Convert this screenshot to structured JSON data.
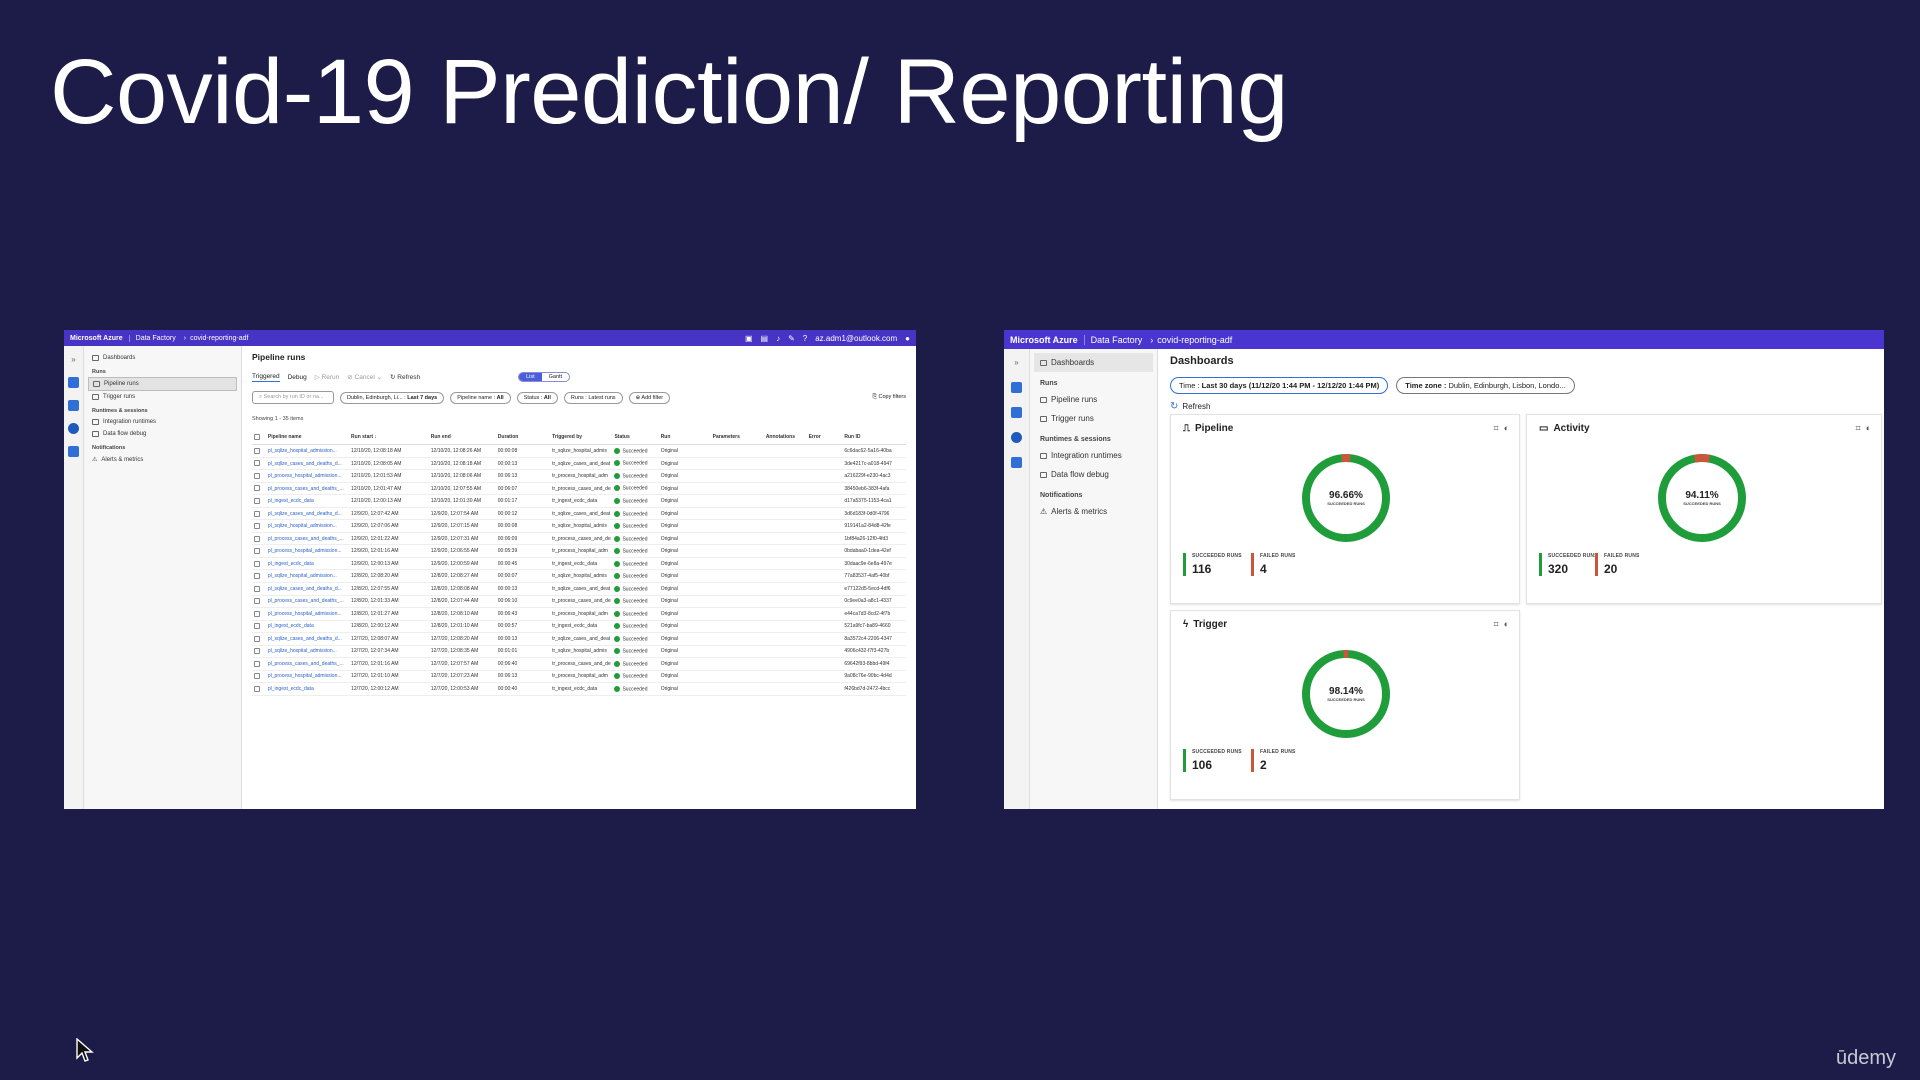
{
  "slide": {
    "title": "Covid-19 Prediction/ Reporting",
    "watermark": "ūdemy"
  },
  "left_shot": {
    "topbar": {
      "brand": "Microsoft Azure",
      "crumb1": "Data Factory",
      "crumb2": "covid-reporting-adf",
      "user": "az.adm1@outlook.com",
      "icons": [
        "cloud-shell-icon",
        "directory-icon",
        "bell-icon",
        "gear-icon",
        "help-icon",
        "avatar"
      ]
    },
    "nav": {
      "dashboards": "Dashboards",
      "runs_section": "Runs",
      "pipeline_runs": "Pipeline runs",
      "trigger_runs": "Trigger runs",
      "runtimes_section": "Runtimes & sessions",
      "integration_runtimes": "Integration runtimes",
      "data_flow_debug": "Data flow debug",
      "notifications_section": "Notifications",
      "alerts": "Alerts & metrics"
    },
    "page_title": "Pipeline runs",
    "tabs": {
      "triggered": "Triggered",
      "debug": "Debug"
    },
    "toolbar": {
      "rerun": "Rerun",
      "cancel": "Cancel",
      "refresh": "Refresh",
      "list": "List",
      "gantt": "Gantt"
    },
    "filters": {
      "search_placeholder": "Search by run ID or na...",
      "timezone": "Dublin, Edinburgh, Li...",
      "range": "Last 7 days",
      "pipeline_name": "Pipeline name : ",
      "pipeline_name_val": "All",
      "status": "Status : ",
      "status_val": "All",
      "runs": "Runs : Latest runs",
      "add_filter": "Add filter",
      "copy_filters": "Copy filters"
    },
    "showing": "Showing 1 - 35 items",
    "columns": [
      "Pipeline name",
      "Run start ↓",
      "Run end",
      "Duration",
      "Triggered by",
      "Status",
      "Run",
      "Parameters",
      "Annotations",
      "Error",
      "Run ID"
    ],
    "rows": [
      [
        "pl_sqlize_hospital_admission...",
        "12/10/20, 12:08:18 AM",
        "12/10/20, 12:08:26 AM",
        "00:00:08",
        "tr_sqlize_hospital_admis",
        "Succeeded",
        "Original",
        "6c6dac62-5a16-40ba"
      ],
      [
        "pl_sqlize_cases_and_deaths_d...",
        "12/10/20, 12:08:05 AM",
        "12/10/20, 12:08:18 AM",
        "00:00:13",
        "tr_sqlize_cases_and_deat",
        "Succeeded",
        "Original",
        "3de4217c-a018-4947"
      ],
      [
        "pl_process_hospital_admission...",
        "12/10/20, 12:01:53 AM",
        "12/10/20, 12:08:06 AM",
        "00:06:13",
        "tr_process_hospital_adm",
        "Succeeded",
        "Original",
        "a216229f-e230-4ac3"
      ],
      [
        "pl_process_cases_and_deaths_...",
        "12/10/20, 12:01:47 AM",
        "12/10/20, 12:07:55 AM",
        "00:06:07",
        "tr_process_cases_and_de",
        "Succeeded",
        "Original",
        "38450eb6-383f-4afa"
      ],
      [
        "pl_ingest_ecdc_data",
        "12/10/20, 12:00:13 AM",
        "12/10/20, 12:01:30 AM",
        "00:01:17",
        "tr_ingest_ecdc_data",
        "Succeeded",
        "Original",
        "d17a5375-1153-4ca1"
      ],
      [
        "pl_sqlize_cases_and_deaths_d...",
        "12/9/20, 12:07:42 AM",
        "12/9/20, 12:07:54 AM",
        "00:00:12",
        "tr_sqlize_cases_and_deat",
        "Succeeded",
        "Original",
        "3d6d183f-0d0f-4796"
      ],
      [
        "pl_sqlize_hospital_admission...",
        "12/9/20, 12:07:06 AM",
        "12/9/20, 12:07:15 AM",
        "00:00:08",
        "tr_sqlize_hospital_admis",
        "Succeeded",
        "Original",
        "919141a2-84d8-42fe"
      ],
      [
        "pl_process_cases_and_deaths_...",
        "12/9/20, 12:01:22 AM",
        "12/9/20, 12:07:31 AM",
        "00:06:09",
        "tr_process_cases_and_de",
        "Succeeded",
        "Original",
        "1bf84a26-12f0-4fd3"
      ],
      [
        "pl_process_hospital_admission...",
        "12/9/20, 12:01:16 AM",
        "12/9/20, 12:06:55 AM",
        "00:05:39",
        "tr_process_hospital_adm",
        "Succeeded",
        "Original",
        "0bdabaa0-1dea-42ef"
      ],
      [
        "pl_ingest_ecdc_data",
        "12/9/20, 12:00:13 AM",
        "12/9/20, 12:00:59 AM",
        "00:00:45",
        "tr_ingest_ecdc_data",
        "Succeeded",
        "Original",
        "30daac9e-6e8a-497e"
      ],
      [
        "pl_sqlize_hospital_admission...",
        "12/8/20, 12:08:20 AM",
        "12/8/20, 12:08:27 AM",
        "00:00:07",
        "tr_sqlize_hospital_admis",
        "Succeeded",
        "Original",
        "77a83537-4af5-40bf"
      ],
      [
        "pl_sqlize_cases_and_deaths_d...",
        "12/8/20, 12:07:55 AM",
        "12/8/20, 12:08:08 AM",
        "00:00:13",
        "tr_sqlize_cases_and_deat",
        "Succeeded",
        "Original",
        "e77122d5-5ecd-4df6"
      ],
      [
        "pl_process_cases_and_deaths_...",
        "12/8/20, 12:01:33 AM",
        "12/8/20, 12:07:44 AM",
        "00:06:10",
        "tr_process_cases_and_de",
        "Succeeded",
        "Original",
        "0c9ee0a3-a8c1-4337"
      ],
      [
        "pl_process_hospital_admission...",
        "12/8/20, 12:01:27 AM",
        "12/8/20, 12:08:10 AM",
        "00:06:43",
        "tr_process_hospital_adm",
        "Succeeded",
        "Original",
        "e44ca7d3-8cd2-4f7b"
      ],
      [
        "pl_ingest_ecdc_data",
        "12/8/20, 12:00:12 AM",
        "12/8/20, 12:01:10 AM",
        "00:00:57",
        "tr_ingest_ecdc_data",
        "Succeeded",
        "Original",
        "521a9fc7-ba89-4660"
      ],
      [
        "pl_sqlize_cases_and_deaths_d...",
        "12/7/20, 12:08:07 AM",
        "12/7/20, 12:08:20 AM",
        "00:00:13",
        "tr_sqlize_cases_and_deat",
        "Succeeded",
        "Original",
        "8a3572c4-2206-4347"
      ],
      [
        "pl_sqlize_hospital_admission...",
        "12/7/20, 12:07:34 AM",
        "12/7/20, 12:08:35 AM",
        "00:01:01",
        "tr_sqlize_hospital_admis",
        "Succeeded",
        "Original",
        "4906c432-f7f3-427b"
      ],
      [
        "pl_process_cases_and_deaths_...",
        "12/7/20, 12:01:16 AM",
        "12/7/20, 12:07:57 AM",
        "00:06:40",
        "tr_process_cases_and_de",
        "Succeeded",
        "Original",
        "69642f93-8bbd-49f4"
      ],
      [
        "pl_process_hospital_admission...",
        "12/7/20, 12:01:10 AM",
        "12/7/20, 12:07:23 AM",
        "00:06:13",
        "tr_process_hospital_adm",
        "Succeeded",
        "Original",
        "9a08c76e-90bc-4d4d"
      ],
      [
        "pl_ingest_ecdc_data",
        "12/7/20, 12:00:12 AM",
        "12/7/20, 12:00:53 AM",
        "00:00:40",
        "tr_ingest_ecdc_data",
        "Succeeded",
        "Original",
        "f426bd7d-2472-4bcc"
      ]
    ]
  },
  "right_shot": {
    "topbar": {
      "brand": "Microsoft Azure",
      "crumb1": "Data Factory",
      "crumb2": "covid-reporting-adf"
    },
    "nav": {
      "dashboards": "Dashboards",
      "runs_section": "Runs",
      "pipeline_runs": "Pipeline runs",
      "trigger_runs": "Trigger runs",
      "runtimes_section": "Runtimes & sessions",
      "integration_runtimes": "Integration runtimes",
      "data_flow_debug": "Data flow debug",
      "notifications_section": "Notifications",
      "alerts": "Alerts & metrics"
    },
    "page_title": "Dashboards",
    "time_label": "Time : ",
    "time_value": "Last 30 days (11/12/20 1:44 PM - 12/12/20 1:44 PM)",
    "tz_label": "Time zone : ",
    "tz_value": "Dublin, Edinburgh, Lisbon, Londo...",
    "refresh": "Refresh",
    "succeeded_label": "SUCCEEDED RUNS",
    "failed_label": "FAILED RUNS",
    "colors": {
      "success": "#1f9d3a",
      "fail": "#c9573a"
    },
    "cards": {
      "pipeline": {
        "title": "Pipeline",
        "pct": "96.66%",
        "succeeded": "116",
        "failed": "4",
        "fraction": 0.9666
      },
      "activity": {
        "title": "Activity",
        "pct": "94.11%",
        "succeeded": "320",
        "failed": "20",
        "fraction": 0.9411
      },
      "trigger": {
        "title": "Trigger",
        "pct": "98.14%",
        "succeeded": "106",
        "failed": "2",
        "fraction": 0.9814
      }
    }
  }
}
